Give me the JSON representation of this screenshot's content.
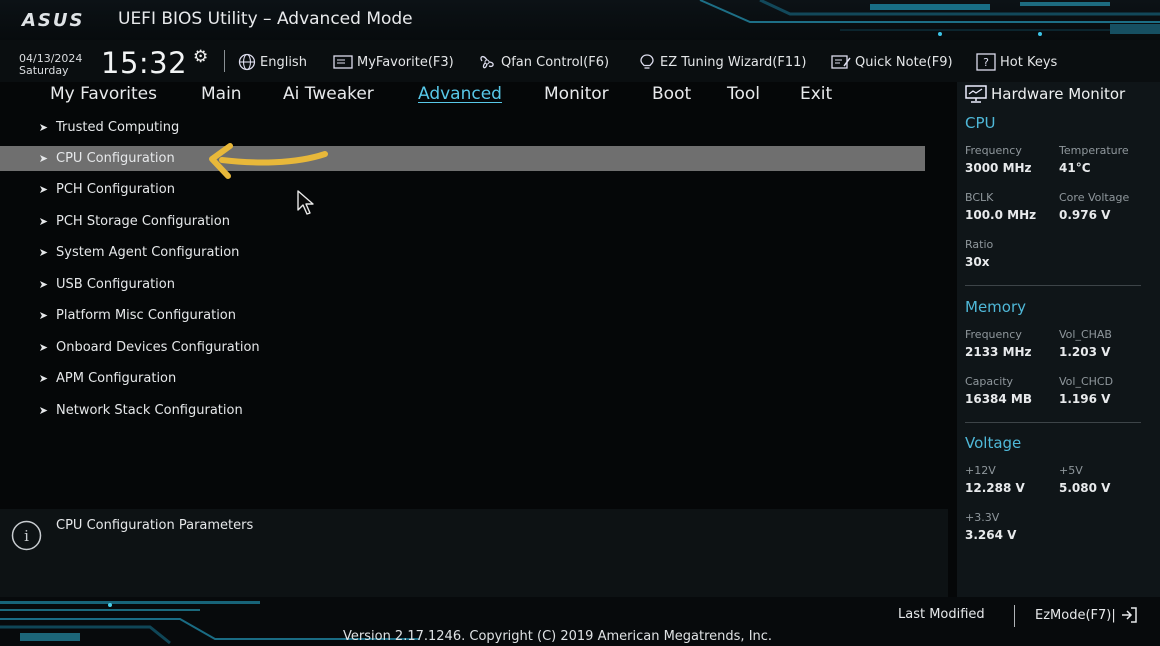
{
  "header": {
    "logo": "ASUS",
    "title": "UEFI BIOS Utility – Advanced Mode"
  },
  "toolbar": {
    "date": "04/13/2024",
    "day": "Saturday",
    "time": "15:32",
    "language": "English",
    "favorite": "MyFavorite(F3)",
    "qfan": "Qfan Control(F6)",
    "ez_tuning": "EZ Tuning Wizard(F11)",
    "quick_note": "Quick Note(F9)",
    "hot_keys": "Hot Keys"
  },
  "tabs": [
    {
      "label": "My Favorites"
    },
    {
      "label": "Main"
    },
    {
      "label": "Ai Tweaker"
    },
    {
      "label": "Advanced",
      "active": true
    },
    {
      "label": "Monitor"
    },
    {
      "label": "Boot"
    },
    {
      "label": "Tool"
    },
    {
      "label": "Exit"
    }
  ],
  "menu": {
    "items": [
      {
        "label": "Trusted Computing"
      },
      {
        "label": "CPU Configuration",
        "selected": true
      },
      {
        "label": "PCH Configuration"
      },
      {
        "label": "PCH Storage Configuration"
      },
      {
        "label": "System Agent Configuration"
      },
      {
        "label": "USB Configuration"
      },
      {
        "label": "Platform Misc Configuration"
      },
      {
        "label": "Onboard Devices Configuration"
      },
      {
        "label": "APM Configuration"
      },
      {
        "label": "Network Stack Configuration"
      }
    ],
    "help_text": "CPU Configuration Parameters"
  },
  "hardware_monitor": {
    "title": "Hardware Monitor",
    "cpu": {
      "heading": "CPU",
      "frequency_label": "Frequency",
      "frequency": "3000 MHz",
      "temperature_label": "Temperature",
      "temperature": "41°C",
      "bclk_label": "BCLK",
      "bclk": "100.0 MHz",
      "core_voltage_label": "Core Voltage",
      "core_voltage": "0.976 V",
      "ratio_label": "Ratio",
      "ratio": "30x"
    },
    "memory": {
      "heading": "Memory",
      "frequency_label": "Frequency",
      "frequency": "2133 MHz",
      "vol_chab_label": "Vol_CHAB",
      "vol_chab": "1.203 V",
      "capacity_label": "Capacity",
      "capacity": "16384 MB",
      "vol_chcd_label": "Vol_CHCD",
      "vol_chcd": "1.196 V"
    },
    "voltage": {
      "heading": "Voltage",
      "v12_label": "+12V",
      "v12": "12.288 V",
      "v5_label": "+5V",
      "v5": "5.080 V",
      "v33_label": "+3.3V",
      "v33": "3.264 V"
    }
  },
  "footer": {
    "last_modified": "Last Modified",
    "ez_mode": "EzMode(F7)|",
    "version": "Version 2.17.1246. Copyright (C) 2019 American Megatrends, Inc."
  },
  "colors": {
    "accent": "#58c8e8",
    "selected_row": "#6f6f6f",
    "annotation_arrow": "#e8b83a"
  }
}
